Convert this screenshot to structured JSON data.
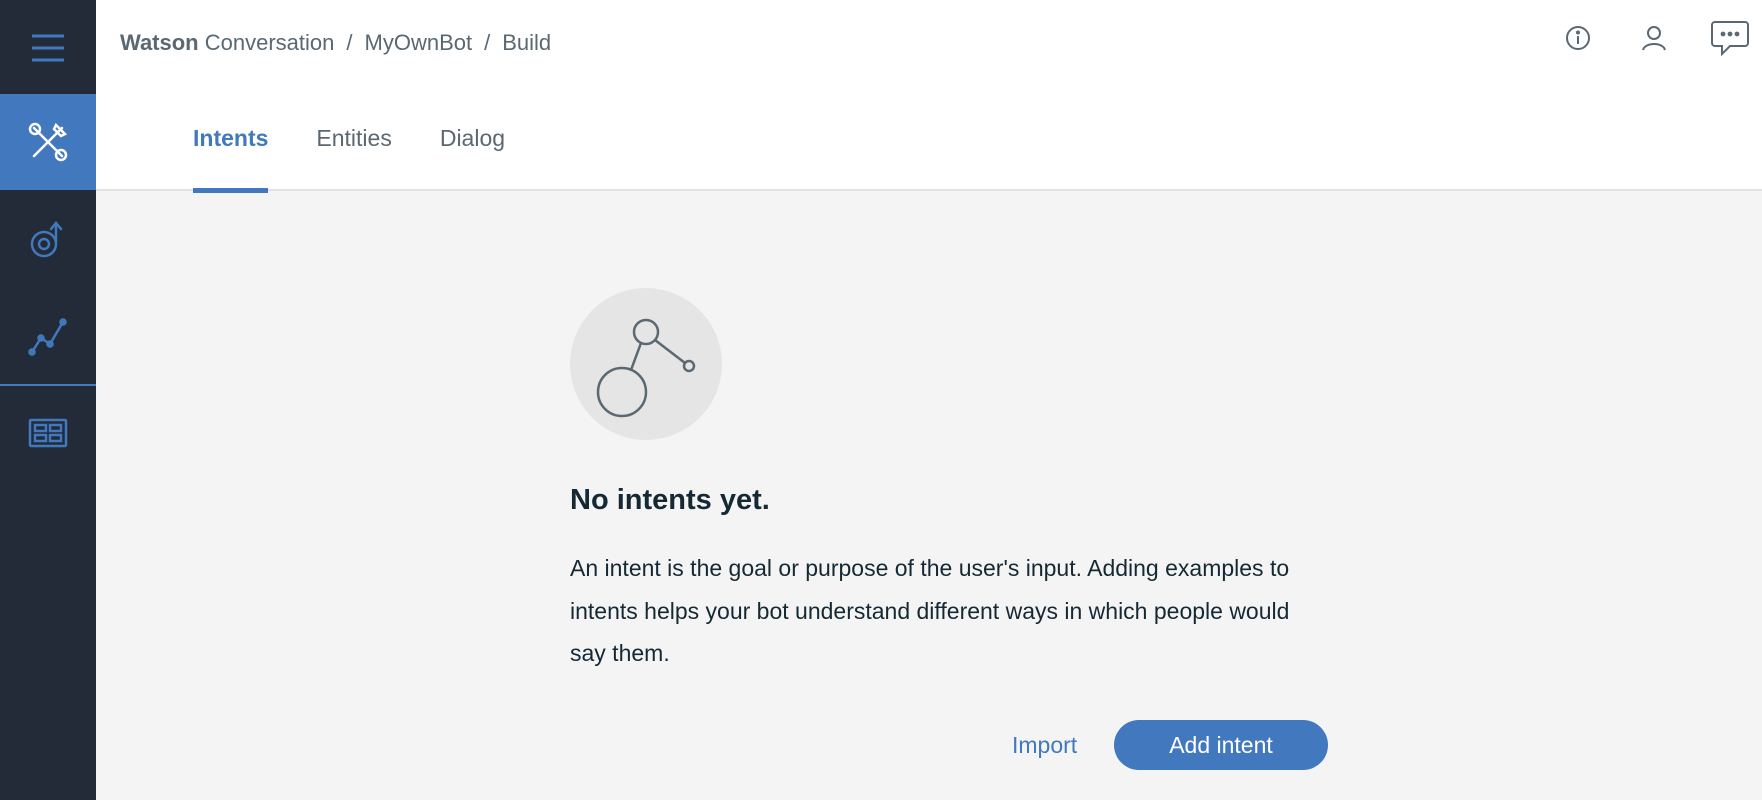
{
  "sidebar": {
    "items": [
      {
        "icon": "hamburger-menu-icon"
      },
      {
        "icon": "build-tools-icon",
        "active": true
      },
      {
        "icon": "improve-icon"
      },
      {
        "icon": "analytics-icon"
      },
      {
        "icon": "workspaces-icon"
      }
    ]
  },
  "header": {
    "breadcrumb": {
      "brand_bold": "Watson",
      "brand_rest": "Conversation",
      "separator": "/",
      "workspace": "MyOwnBot",
      "section": "Build"
    },
    "icons": [
      "info-icon",
      "user-icon",
      "chat-feedback-icon"
    ]
  },
  "tabs": [
    {
      "label": "Intents",
      "active": true
    },
    {
      "label": "Entities",
      "active": false
    },
    {
      "label": "Dialog",
      "active": false
    }
  ],
  "empty_state": {
    "title": "No intents yet.",
    "description": "An intent is the goal or purpose of the user's input. Adding examples to intents helps your bot understand different ways in which people would say them.",
    "import_label": "Import",
    "add_label": "Add intent"
  },
  "colors": {
    "sidebar_bg": "#232b38",
    "accent": "#4178be",
    "page_bg": "#f4f4f4",
    "text": "#152935",
    "muted_text": "#5a6872"
  }
}
